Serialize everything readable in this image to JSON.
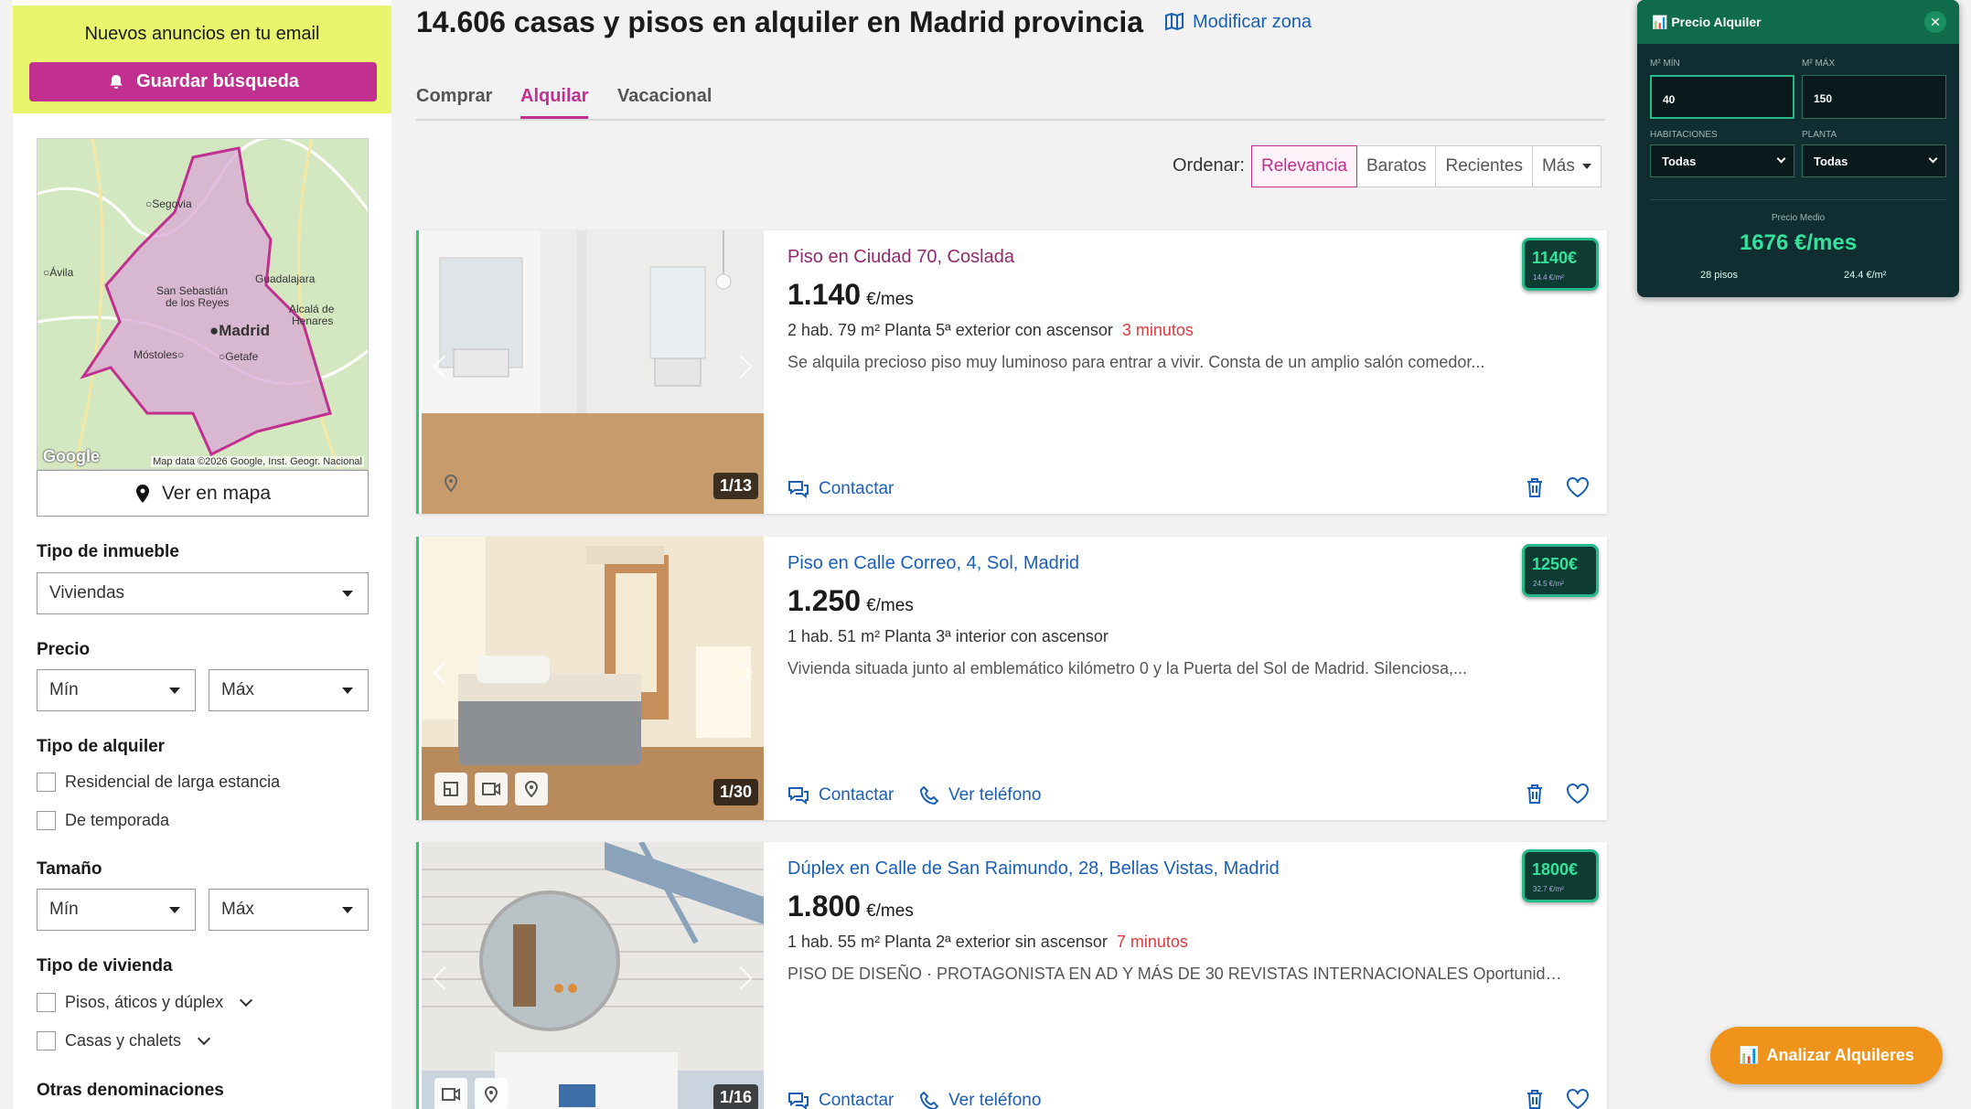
{
  "sidebar": {
    "alert_title": "Nuevos anuncios en tu email",
    "save_search": "Guardar búsqueda",
    "map": {
      "view_map": "Ver en mapa",
      "credit": "Map data ©2026 Google, Inst. Geogr. Nacional",
      "google": "Google",
      "places": [
        "Segovia",
        "Ávila",
        "Guadalajara",
        "San Sebastián de los Reyes",
        "Alcalá de Henares",
        "Madrid",
        "Móstoles",
        "Getafe"
      ]
    },
    "property_type": {
      "label": "Tipo de inmueble",
      "value": "Viviendas"
    },
    "price": {
      "label": "Precio",
      "min": "Mín",
      "max": "Máx"
    },
    "rental_type": {
      "label": "Tipo de alquiler",
      "options": [
        "Residencial de larga estancia",
        "De temporada"
      ]
    },
    "size": {
      "label": "Tamaño",
      "min": "Mín",
      "max": "Máx"
    },
    "housing_type": {
      "label": "Tipo de vivienda",
      "options": [
        "Pisos, áticos y dúplex",
        "Casas y chalets"
      ]
    },
    "other": {
      "label": "Otras denominaciones"
    }
  },
  "header": {
    "title": "14.606 casas y pisos en alquiler en Madrid provincia",
    "modify_zone": "Modificar zona",
    "tabs": [
      {
        "label": "Comprar",
        "active": false
      },
      {
        "label": "Alquilar",
        "active": true
      },
      {
        "label": "Vacacional",
        "active": false
      }
    ]
  },
  "sort": {
    "label": "Ordenar:",
    "options": [
      "Relevancia",
      "Baratos",
      "Recientes",
      "Más"
    ],
    "selected": "Relevancia"
  },
  "listings": [
    {
      "title": "Piso en Ciudad 70, Coslada",
      "price": "1.140",
      "unit": "€/mes",
      "details": "2 hab.  79 m²  Planta 5ª exterior con ascensor",
      "time": "3 minutos",
      "description": "Se alquila precioso piso muy luminoso para entrar a vivir. Consta de un amplio salón comedor...",
      "photo_counter": "1/13",
      "contact": "Contactar",
      "phone": "",
      "badge_price": "1140€",
      "badge_sub": "14.4 €/m²"
    },
    {
      "title": "Piso en Calle Correo, 4, Sol, Madrid",
      "price": "1.250",
      "unit": "€/mes",
      "details": "1 hab.  51 m²  Planta 3ª interior con ascensor",
      "time": "",
      "description": "Vivienda situada junto al emblemático kilómetro 0 y la Puerta del Sol de Madrid. Silenciosa,...",
      "photo_counter": "1/30",
      "contact": "Contactar",
      "phone": "Ver teléfono",
      "badge_price": "1250€",
      "badge_sub": "24.5 €/m²"
    },
    {
      "title": "Dúplex en Calle de San Raimundo, 28, Bellas Vistas, Madrid",
      "price": "1.800",
      "unit": "€/mes",
      "details": "1 hab.  55 m²  Planta 2ª exterior sin ascensor",
      "time": "7 minutos",
      "description": "PISO DE DISEÑO · PROTAGONISTA EN AD Y MÁS DE 30 REVISTAS INTERNACIONALES Oportunidad...",
      "photo_counter": "1/16",
      "contact": "Contactar",
      "phone": "Ver teléfono",
      "badge_price": "1800€",
      "badge_sub": "32.7 €/m²"
    }
  ],
  "panel": {
    "title": "Precio Alquiler",
    "m2_min_label": "M² MÍN",
    "m2_min": "40",
    "m2_max_label": "M² MÁX",
    "m2_max": "150",
    "rooms_label": "HABITACIONES",
    "rooms": "Todas",
    "floor_label": "PLANTA",
    "floor": "Todas",
    "avg_label": "Precio Medio",
    "avg_value": "1676 €/mes",
    "count": "28 pisos",
    "per_m2": "24.4 €/m²"
  },
  "analyze_button": "Analizar Alquileres",
  "colors": {
    "accent": "#c12f8f",
    "link": "#1a5fb4",
    "panel": "#102e32",
    "panel_accent": "#33e29b",
    "analyze": "#f0931b"
  }
}
